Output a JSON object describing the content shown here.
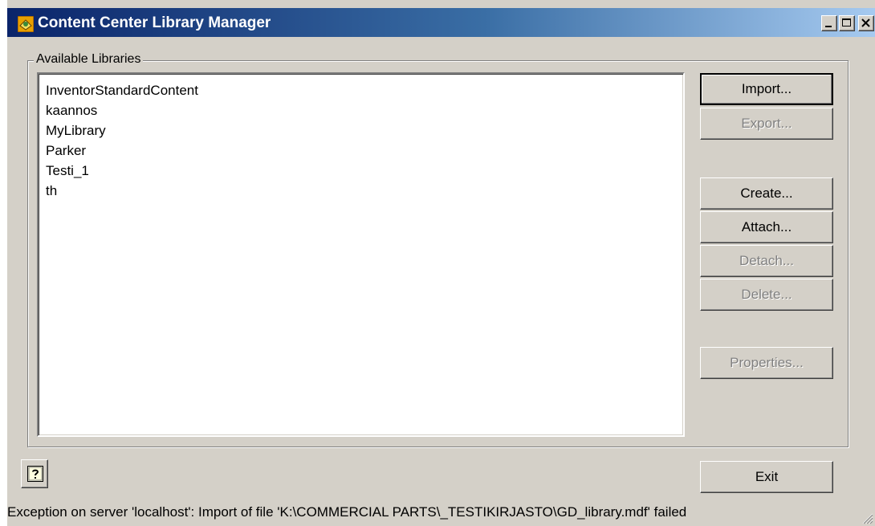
{
  "window": {
    "title": "Content Center Library Manager"
  },
  "caption_buttons": {
    "minimize": "minimize",
    "maximize": "maximize",
    "close": "close"
  },
  "libraries": {
    "group_label": "Available Libraries",
    "items": [
      "InventorStandardContent",
      "kaannos",
      "MyLibrary",
      "Parker",
      "Testi_1",
      "th"
    ]
  },
  "buttons": {
    "import": "Import...",
    "export": "Export...",
    "create": "Create...",
    "attach": "Attach...",
    "detach": "Detach...",
    "delete": "Delete...",
    "properties": "Properties...",
    "exit": "Exit"
  },
  "status": {
    "message": "Exception on server 'localhost': Import of file 'K:\\COMMERCIAL PARTS\\_TESTIKIRJASTO\\GD_library.mdf' failed"
  },
  "colors": {
    "titlebar_start": "#0a246a",
    "titlebar_end": "#a6caf0",
    "dialog_face": "#d4d0c8",
    "disabled_text": "#808080"
  }
}
